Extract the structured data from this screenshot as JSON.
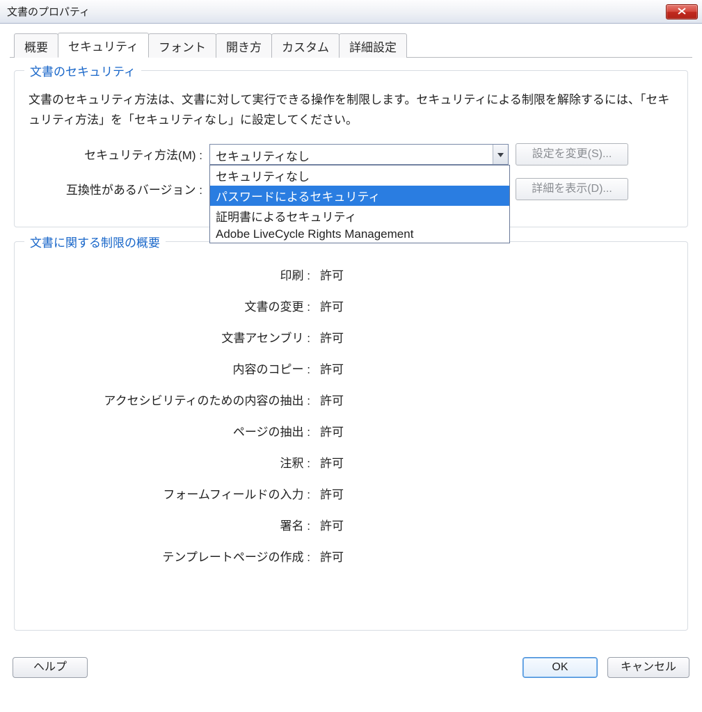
{
  "title": "文書のプロパティ",
  "tabs": [
    "概要",
    "セキュリティ",
    "フォント",
    "開き方",
    "カスタム",
    "詳細設定"
  ],
  "active_tab": 1,
  "group_security": {
    "legend": "文書のセキュリティ",
    "description": "文書のセキュリティ方法は、文書に対して実行できる操作を制限します。セキュリティによる制限を解除するには、「セキュリティ方法」を「セキュリティなし」に設定してください。",
    "security_method_label": "セキュリティ方法(M) :",
    "security_method_value": "セキュリティなし",
    "security_method_options": [
      "セキュリティなし",
      "パスワードによるセキュリティ",
      "証明書によるセキュリティ",
      "Adobe LiveCycle Rights Management"
    ],
    "highlighted_option_index": 1,
    "compat_label": "互換性があるバージョン :",
    "change_settings_label": "設定を変更(S)...",
    "show_details_label": "詳細を表示(D)..."
  },
  "group_restrictions": {
    "legend": "文書に関する制限の概要",
    "rows": [
      {
        "label": "印刷 :",
        "value": "許可"
      },
      {
        "label": "文書の変更 :",
        "value": "許可"
      },
      {
        "label": "文書アセンブリ :",
        "value": "許可"
      },
      {
        "label": "内容のコピー :",
        "value": "許可"
      },
      {
        "label": "アクセシビリティのための内容の抽出 :",
        "value": "許可"
      },
      {
        "label": "ページの抽出 :",
        "value": "許可"
      },
      {
        "label": "注釈 :",
        "value": "許可"
      },
      {
        "label": "フォームフィールドの入力 :",
        "value": "許可"
      },
      {
        "label": "署名 :",
        "value": "許可"
      },
      {
        "label": "テンプレートページの作成 :",
        "value": "許可"
      }
    ]
  },
  "footer": {
    "help": "ヘルプ",
    "ok": "OK",
    "cancel": "キャンセル"
  }
}
